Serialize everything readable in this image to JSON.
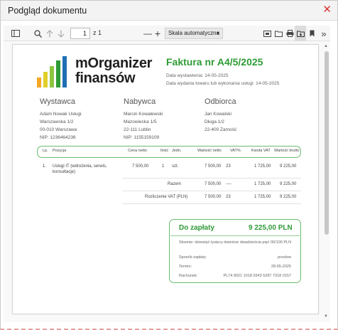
{
  "window": {
    "title": "Podgląd dokumentu",
    "close_glyph": "✕"
  },
  "toolbar": {
    "page_current": "1",
    "page_total": "z 1",
    "zoom_minus": "—",
    "zoom_plus": "+",
    "zoom_value": "Skala automatyczna",
    "zoom_caret": "▾",
    "more": "»"
  },
  "invoice": {
    "logo_line1": "mOrganizer",
    "logo_line2": "finansów",
    "logo_bar_colors": [
      "#f5a623",
      "#e0cf2b",
      "#8cc63f",
      "#2e9b35",
      "#1f6fb5"
    ],
    "title": "Faktura nr A4/5/2025",
    "date_issued": "Data wystawienia: 14-05-2025",
    "date_delivery": "Data wydania towaru lub wykonania usługi: 14-05-2025",
    "seller": {
      "heading": "Wystawca",
      "lines": [
        "Adam Nowak Usługi",
        "Warszawska 1/2",
        "00-010 Warszawa",
        "NIP: 1236464236"
      ]
    },
    "buyer": {
      "heading": "Nabywca",
      "lines": [
        "Marcin Kowalewski",
        "Mazowiecka 1/5",
        "22-111 Lublin",
        "NIP: 1155159109"
      ]
    },
    "recipient": {
      "heading": "Odbiorca",
      "lines": [
        "Jan Kowalski",
        "Długa 1/2",
        "22-400 Zamość"
      ]
    },
    "table": {
      "headers": [
        "Lp.",
        "Pozycja",
        "Cena netto",
        "Ilość",
        "Jedn.",
        "Wartość netto",
        "VAT%",
        "Kwota VAT",
        "Wartość brutto"
      ],
      "row": {
        "lp": "1.",
        "name_line1": "Usługi IT (wdrożenia, serwis,",
        "name_line2": "konsultacje)",
        "price": "7 500,00",
        "qty": "1",
        "unit": "szt.",
        "net": "7 500,00",
        "vat_rate": "23",
        "vat": "1 725,00",
        "gross": "9 225,00"
      },
      "total": {
        "label": "Razem",
        "net": "7 500,00",
        "vat_rate": "----",
        "vat": "1 725,00",
        "gross": "9 225,00"
      },
      "vat_summary": {
        "label": "Rozliczenie VAT (PLN)",
        "net": "7 500,00",
        "vat_rate": "23",
        "vat": "1 725,00",
        "gross": "9 225,00"
      }
    },
    "payment": {
      "label": "Do zapłaty",
      "amount": "9 225,00 PLN",
      "words": "Słownie: dziewięć tysięcy dwieście dwadzieścia pięć 00/100 PLN",
      "method_label": "Sposób zapłaty:",
      "method_value": "przelew",
      "due_label": "Termin:",
      "due_value": "28-05-2025",
      "account_label": "Rachunek:",
      "account_value": "PL74 9021 1018 0343 5287 7318 0157"
    }
  },
  "scrollbar": {
    "up": "▲",
    "down": "▼"
  }
}
